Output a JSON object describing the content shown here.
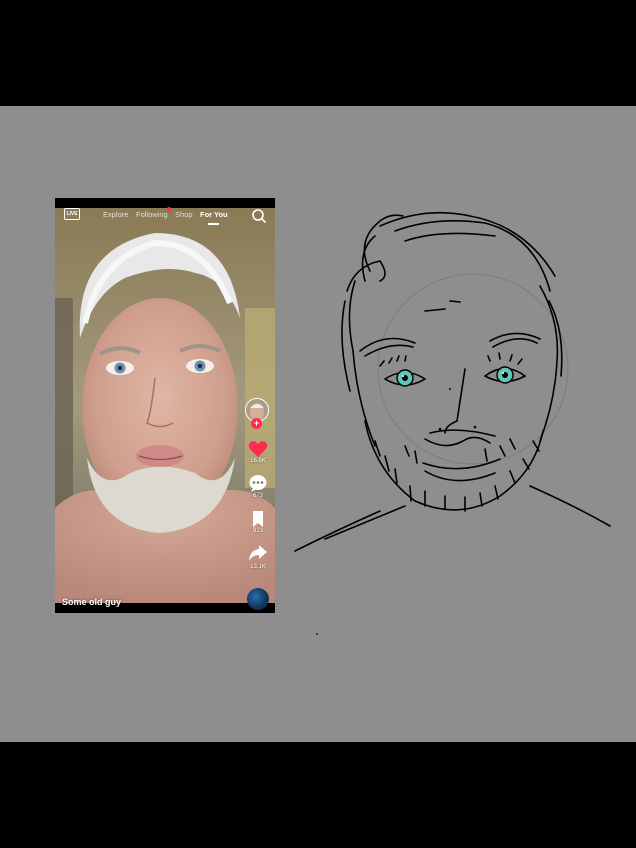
{
  "phone": {
    "live_label": "LIVE",
    "tabs": [
      {
        "label": "Explore",
        "active": false
      },
      {
        "label": "Following",
        "active": false,
        "has_dot": true
      },
      {
        "label": "Shop",
        "active": false
      },
      {
        "label": "For You",
        "active": true
      }
    ],
    "rail": {
      "likes": "16.8K",
      "comments": "673",
      "saves": "923",
      "shares": "13.1K"
    },
    "caption": "Some old guy"
  },
  "colors": {
    "canvas_bg": "#8e8e8e",
    "accent_pink": "#fe2c55",
    "sketch_eye": "#5fc6b9"
  },
  "icons": [
    "live-icon",
    "search-icon",
    "heart-icon",
    "comment-icon",
    "bookmark-icon",
    "share-icon",
    "music-disc-icon"
  ]
}
